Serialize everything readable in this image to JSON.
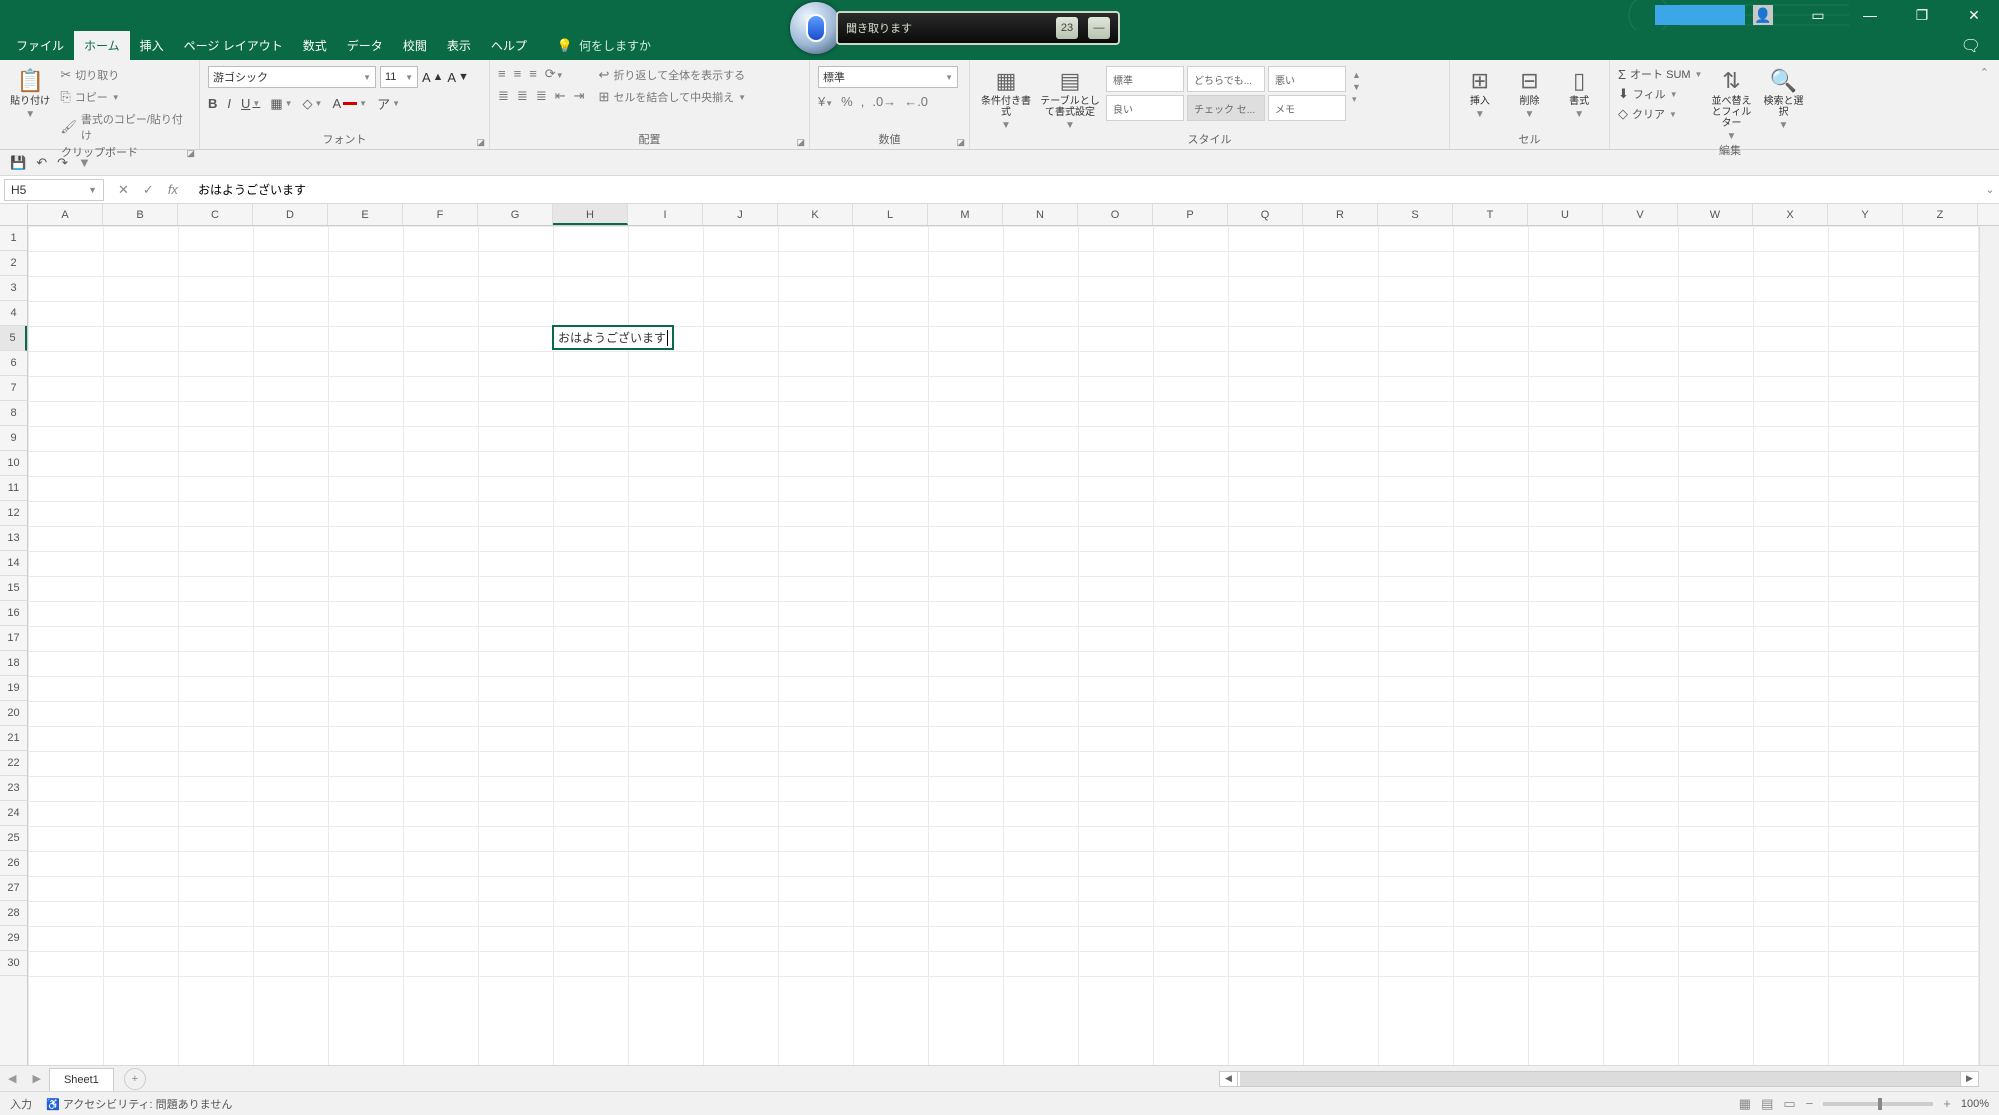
{
  "window": {
    "minimize": "—",
    "maximize": "▭",
    "restore": "❐",
    "close": "✕",
    "comments": "💬"
  },
  "voice": {
    "status": "聞き取ります",
    "alt": "23",
    "min": "—"
  },
  "tabs": {
    "file": "ファイル",
    "home": "ホーム",
    "insert": "挿入",
    "layout": "ページ レイアウト",
    "formulas": "数式",
    "data": "データ",
    "review": "校閲",
    "view": "表示",
    "help": "ヘルプ",
    "tellme": "何をしますか"
  },
  "ribbon": {
    "clipboard": {
      "label": "クリップボード",
      "paste": "貼り付け",
      "cut": "切り取り",
      "copy": "コピー",
      "painter": "書式のコピー/貼り付け"
    },
    "font": {
      "label": "フォント",
      "name": "游ゴシック",
      "size": "11",
      "bold": "B",
      "italic": "I",
      "underline": "U"
    },
    "align": {
      "label": "配置",
      "wrap": "折り返して全体を表示する",
      "merge": "セルを結合して中央揃え"
    },
    "number": {
      "label": "数値",
      "format": "標準"
    },
    "condfmt": "条件付き書式",
    "tablefmt": "テーブルとして書式設定",
    "styles": {
      "label": "スタイル",
      "s1": "標準",
      "s2": "どちらでも...",
      "s3": "悪い",
      "s4": "良い",
      "s5": "チェック セ...",
      "s6": "メモ"
    },
    "cells": {
      "label": "セル",
      "insert": "挿入",
      "delete": "削除",
      "format": "書式"
    },
    "editing": {
      "label": "編集",
      "autosum": "オート SUM",
      "fill": "フィル",
      "clear": "クリア",
      "sort": "並べ替えとフィルター",
      "find": "検索と選択"
    }
  },
  "qat": {
    "save": "💾",
    "undo": "↶",
    "redo": "↷"
  },
  "formulabar": {
    "cellref": "H5",
    "cancel": "✕",
    "enter": "✓",
    "fx": "fx",
    "value": "おはようございます"
  },
  "grid": {
    "cols": [
      "A",
      "B",
      "C",
      "D",
      "E",
      "F",
      "G",
      "H",
      "I",
      "J",
      "K",
      "L",
      "M",
      "N",
      "O",
      "P",
      "Q",
      "R",
      "S",
      "T",
      "U",
      "V",
      "W",
      "X",
      "Y",
      "Z"
    ],
    "rows": 30,
    "active": {
      "col": "H",
      "row": 5,
      "value": "おはようございます"
    }
  },
  "sheets": {
    "name": "Sheet1",
    "add": "+"
  },
  "status": {
    "mode": "入力",
    "accessibility": "アクセシビリティ: 問題ありません",
    "zoom": "100%"
  }
}
